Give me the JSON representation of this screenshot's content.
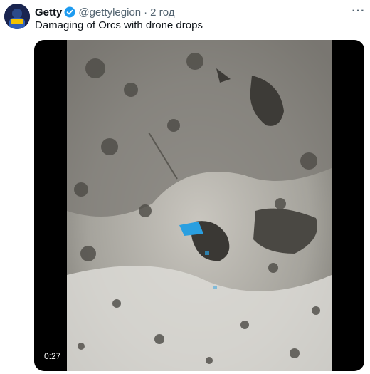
{
  "tweet": {
    "author_name": "Getty",
    "handle": "@gettylegion",
    "separator": "·",
    "time": "2 год",
    "text": "Damaging of Orcs with drone drops",
    "video": {
      "duration": "0:27"
    }
  },
  "icons": {
    "verified": "verified-badge-icon",
    "more": "more-options-icon"
  },
  "colors": {
    "verified": "#1d9bf0",
    "text_primary": "#0f1419",
    "text_secondary": "#536471",
    "video_letterbox": "#000000",
    "blue_marker": "#2a9fe0"
  }
}
